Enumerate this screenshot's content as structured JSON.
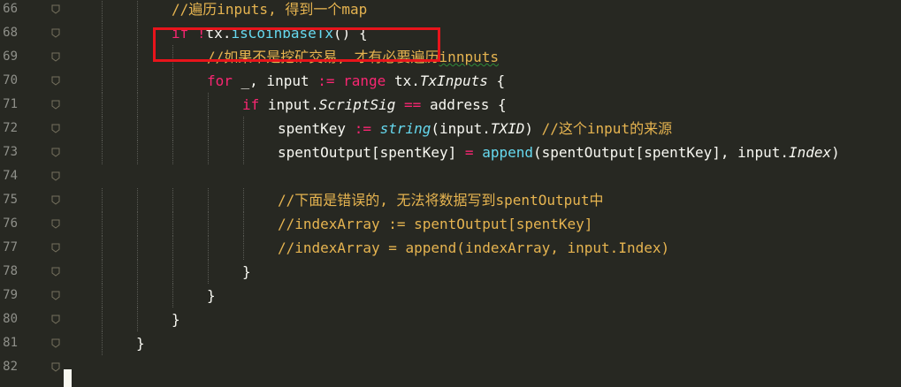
{
  "editor": {
    "lines": [
      {
        "num": "66",
        "indent": 3,
        "tokens": [
          {
            "t": "//遍历inputs, 得到一个map",
            "c": "cm"
          }
        ]
      },
      {
        "num": "68",
        "indent": 3,
        "tokens": [
          {
            "t": "if ",
            "c": "kw"
          },
          {
            "t": "!",
            "c": "kw"
          },
          {
            "t": "tx.",
            "c": ""
          },
          {
            "t": "isCoinbaseTx",
            "c": "fn"
          },
          {
            "t": "() {",
            "c": ""
          }
        ]
      },
      {
        "num": "69",
        "indent": 4,
        "tokens": [
          {
            "t": "//如果不是挖矿交易, 才有必要遍历",
            "c": "cm"
          },
          {
            "t": "innputs",
            "c": "cm sq"
          }
        ]
      },
      {
        "num": "70",
        "indent": 4,
        "tokens": [
          {
            "t": "for ",
            "c": "kw"
          },
          {
            "t": "_, input ",
            "c": ""
          },
          {
            "t": ":= ",
            "c": "kw"
          },
          {
            "t": "range ",
            "c": "kw"
          },
          {
            "t": "tx.",
            "c": ""
          },
          {
            "t": "TxInputs",
            "c": "it"
          },
          {
            "t": " {",
            "c": ""
          }
        ]
      },
      {
        "num": "71",
        "indent": 5,
        "tokens": [
          {
            "t": "if ",
            "c": "kw"
          },
          {
            "t": "input.",
            "c": ""
          },
          {
            "t": "ScriptSig",
            "c": "it"
          },
          {
            "t": " ",
            "c": ""
          },
          {
            "t": "==",
            "c": "kw"
          },
          {
            "t": " address {",
            "c": ""
          }
        ]
      },
      {
        "num": "72",
        "indent": 6,
        "tokens": [
          {
            "t": "spentKey ",
            "c": ""
          },
          {
            "t": ":= ",
            "c": "kw"
          },
          {
            "t": "string",
            "c": "ty it"
          },
          {
            "t": "(input.",
            "c": ""
          },
          {
            "t": "TXID",
            "c": "it"
          },
          {
            "t": ") ",
            "c": ""
          },
          {
            "t": "//这个input的来源",
            "c": "cm"
          }
        ]
      },
      {
        "num": "73",
        "indent": 6,
        "tokens": [
          {
            "t": "spentOutput[spentKey] ",
            "c": ""
          },
          {
            "t": "= ",
            "c": "kw"
          },
          {
            "t": "append",
            "c": "fn"
          },
          {
            "t": "(spentOutput[spentKey], input.",
            "c": ""
          },
          {
            "t": "Index",
            "c": "it"
          },
          {
            "t": ")",
            "c": ""
          }
        ]
      },
      {
        "num": "74",
        "indent": 0,
        "tokens": []
      },
      {
        "num": "75",
        "indent": 6,
        "tokens": [
          {
            "t": "//下面是错误的, 无法将数据写到spentOutput中",
            "c": "cm"
          }
        ]
      },
      {
        "num": "76",
        "indent": 6,
        "tokens": [
          {
            "t": "//indexArray := spentOutput[spentKey]",
            "c": "cm"
          }
        ]
      },
      {
        "num": "77",
        "indent": 6,
        "tokens": [
          {
            "t": "//indexArray = append(indexArray, input.Index)",
            "c": "cm"
          }
        ]
      },
      {
        "num": "78",
        "indent": 5,
        "tokens": [
          {
            "t": "}",
            "c": ""
          }
        ]
      },
      {
        "num": "79",
        "indent": 4,
        "tokens": [
          {
            "t": "}",
            "c": ""
          }
        ]
      },
      {
        "num": "80",
        "indent": 3,
        "tokens": [
          {
            "t": "}",
            "c": ""
          }
        ]
      },
      {
        "num": "81",
        "indent": 2,
        "tokens": [
          {
            "t": "}",
            "c": ""
          }
        ]
      },
      {
        "num": "82",
        "indent": 0,
        "tokens": []
      }
    ]
  },
  "colors": {
    "background": "#272822",
    "highlight_box": "#E8141B",
    "keyword": "#F92672",
    "function": "#66D9EF",
    "comment": "#E6B450"
  }
}
